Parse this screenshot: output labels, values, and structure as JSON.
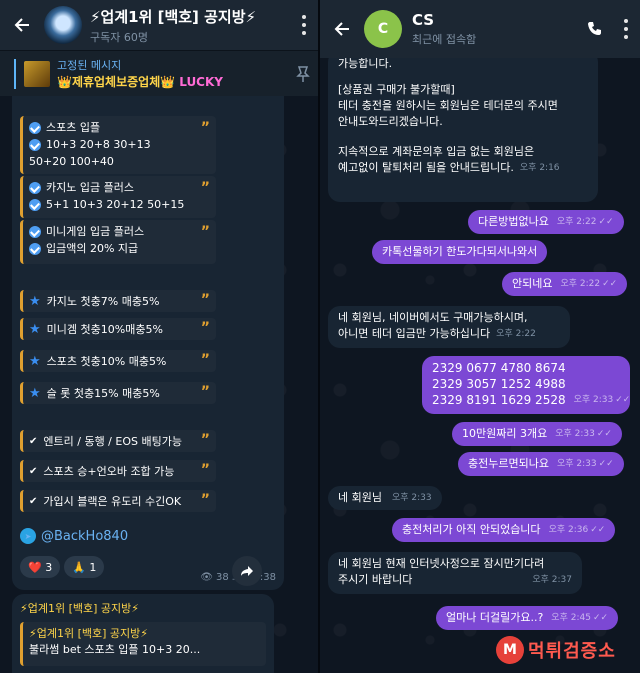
{
  "left": {
    "title": "⚡업계1위 [백호] 공지방⚡",
    "subtitle": "구독자 60명",
    "pinned": {
      "label": "고정된 메시지",
      "text": "👑제휴업체보증업체👑",
      "lucky": "LUCKY"
    },
    "boxes": [
      {
        "title": "스포츠 입플",
        "lines": [
          "10+3 20+8 30+13",
          "50+20 100+40"
        ]
      },
      {
        "title": "카지노 입금 플러스",
        "lines": [
          "5+1 10+3 20+12 50+15"
        ]
      },
      {
        "title": "미니게임 입금 플러스",
        "lines": [
          "입금액의 20% 지급"
        ]
      }
    ],
    "stars": [
      "카지노 첫충7% 매충5%",
      "미니겜 첫충10%매충5%",
      "스포츠 첫충10% 매충5%",
      "슬   롯 첫충15% 매충5%"
    ],
    "checks": [
      "엔트리 / 동행 / EOS 배팅가능",
      "스포츠 승+언오바 조합 가능",
      "가입시 블랙은 유도리 수긴OK"
    ],
    "handle": "@BackHo840",
    "reactions": [
      {
        "emoji": "❤️",
        "count": "3"
      },
      {
        "emoji": "🙏",
        "count": "1"
      }
    ],
    "meta": "👁 38  오후 8:38",
    "next": {
      "title": "⚡업계1위 [백호] 공지방⚡",
      "quote_title": "⚡업계1위 [백호] 공지방⚡",
      "quote_text": "불라썸 bet      스포츠 입플  10+3 20..."
    }
  },
  "right": {
    "name": "CS",
    "avatar_letter": "C",
    "status": "최근에 접속함",
    "msgs_in_top": [
      "가능합니다.",
      "[상품권 구매가 불가할때]",
      "테더 충전을 원하시는 회원님은 테더문의 주시면",
      "안내도와드리겠습니다.",
      "지속적으로 계좌문의후 입금 없는 회원님은",
      "예고없이 탈퇴처리 됨을 안내드립니다."
    ],
    "time_top": "오후 2:16",
    "out1": {
      "text": "다른방법없나요",
      "time": "오후 2:22"
    },
    "out2": {
      "text": "카톡선물하기 한도가다되서나와서",
      "time": ""
    },
    "out3": {
      "text": "안되네요",
      "time": "오후 2:22"
    },
    "in2": {
      "lines": [
        "네 회원님, 네이버에서도 구매가능하시며,",
        "아니면 테더 입금만 가능하십니다"
      ],
      "time": "오후 2:22"
    },
    "codes": [
      "2329 0677 4780 8674",
      "2329 3057 1252 4988",
      "2329 8191 1629 2528"
    ],
    "codes_time": "오후 2:33",
    "out5": {
      "text": "10만원짜리 3개요",
      "time": "오후 2:33"
    },
    "out6": {
      "text": "충전누르면되나요",
      "time": "오후 2:33"
    },
    "in3": {
      "text": "네 회원님",
      "time": "오후 2:33"
    },
    "out7": {
      "text": "충전처리가 아직 안되었습니다",
      "time": "오후 2:36"
    },
    "in4": {
      "lines": [
        "네 회원님 현재 인터넷사정으로 잠시만기다려",
        "주시기 바랍니다"
      ],
      "time": "오후 2:37"
    },
    "out8": {
      "text": "얼마나 더걸릴가요..?",
      "time": "오후 2:45"
    },
    "watermark": "먹튀검증소"
  }
}
